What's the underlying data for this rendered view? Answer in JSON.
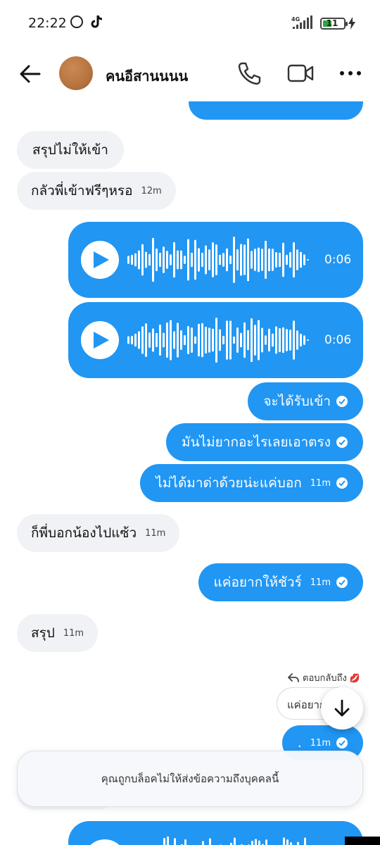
{
  "status_bar": {
    "time": "22:22",
    "network": "4G",
    "battery": "11"
  },
  "header": {
    "contact_name": "คนอีสานนนน"
  },
  "messages": [
    {
      "text": "สรุปไม่ให้เข้า",
      "time": ""
    },
    {
      "text": "กลัวพี่เข้าฟรีๆหรอ",
      "time": "12m"
    },
    {
      "text": "จะได้รับเข้า",
      "time": ""
    },
    {
      "text": "มันไม่ยากอะไรเลยเอาตรง",
      "time": ""
    },
    {
      "text": "ไม่ได้มาด่าด้วยน่ะแค่บอก",
      "time": "11m"
    },
    {
      "text": "ก็พี่บอกน้องไปแซ้ว",
      "time": "11m"
    },
    {
      "text": "แค่อยากให้ชัวร์",
      "time": "11m"
    },
    {
      "text": "สรุป",
      "time": "11m"
    },
    {
      "text": ".",
      "time": "11m"
    }
  ],
  "voice_messages": [
    {
      "duration": "0:06"
    },
    {
      "duration": "0:06"
    }
  ],
  "reply": {
    "label": "ตอบกลับถึง",
    "emoji": "💋",
    "quoted_text": "แค่อยากให้ชัวร์"
  },
  "blocked_banner": "คุณถูกบล็อคไม่ให้ส่งข้อความถึงบุคคลนี้",
  "colors": {
    "accent": "#2196f3",
    "incoming_bubble": "#f0f2f5"
  }
}
